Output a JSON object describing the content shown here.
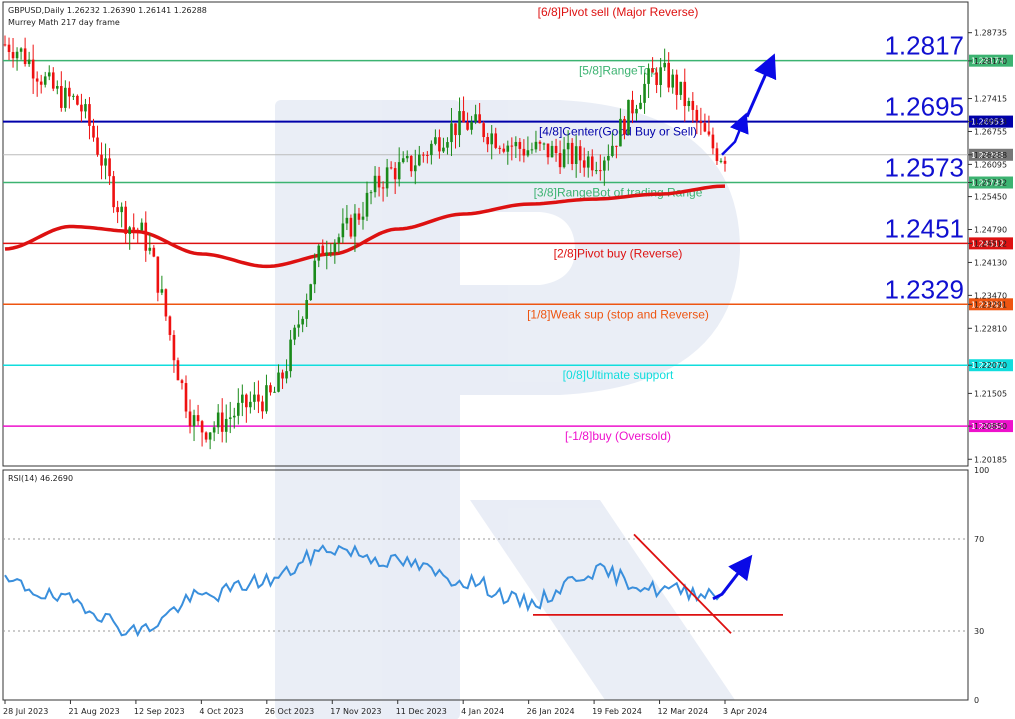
{
  "header": {
    "symbol_info": "GBPUSD,Daily  1.26232 1.26390 1.26141 1.26288",
    "indicator": "Murrey Math 217 day frame"
  },
  "rsi_header": "RSI(14) 46.2690",
  "chart_data": {
    "type": "candlestick",
    "symbol": "GBPUSD",
    "timeframe": "Daily",
    "ohlc_last": {
      "open": 1.26232,
      "high": 1.2639,
      "low": 1.26141,
      "close": 1.26288
    },
    "current_price": 1.26288,
    "price_axis": {
      "range": [
        1.2005,
        1.2935
      ],
      "ticks": [
        1.28735,
        1.2817,
        1.27415,
        1.26953,
        1.26755,
        1.26288,
        1.26095,
        1.25732,
        1.2545,
        1.2479,
        1.24512,
        1.2413,
        1.2347,
        1.23291,
        1.2281,
        1.2207,
        1.21505,
        1.2085,
        1.20185
      ]
    },
    "x_axis_labels": [
      "28 Jul 2023",
      "21 Aug 2023",
      "12 Sep 2023",
      "4 Oct 2023",
      "26 Oct 2023",
      "17 Nov 2023",
      "11 Dec 2023",
      "4 Jan 2024",
      "26 Jan 2024",
      "19 Feb 2024",
      "12 Mar 2024",
      "3 Apr 2024"
    ],
    "close_path": [
      [
        "28 Jul 2023",
        1.285
      ],
      [
        "21 Aug 2023",
        1.274
      ],
      [
        "12 Sep 2023",
        1.248
      ],
      [
        "4 Oct 2023",
        1.208
      ],
      [
        "26 Oct 2023",
        1.214
      ],
      [
        "17 Nov 2023",
        1.246
      ],
      [
        "11 Dec 2023",
        1.26
      ],
      [
        "4 Jan 2024",
        1.269
      ],
      [
        "26 Jan 2024",
        1.264
      ],
      [
        "19 Feb 2024",
        1.262
      ],
      [
        "12 Mar 2024",
        1.279
      ],
      [
        "3 Apr 2024",
        1.2629
      ]
    ],
    "moving_average": [
      [
        "28 Jul 2023",
        1.244
      ],
      [
        "21 Aug 2023",
        1.2485
      ],
      [
        "12 Sep 2023",
        1.2475
      ],
      [
        "4 Oct 2023",
        1.243
      ],
      [
        "26 Oct 2023",
        1.2405
      ],
      [
        "17 Nov 2023",
        1.243
      ],
      [
        "11 Dec 2023",
        1.248
      ],
      [
        "4 Jan 2024",
        1.251
      ],
      [
        "26 Jan 2024",
        1.253
      ],
      [
        "19 Feb 2024",
        1.254
      ],
      [
        "12 Mar 2024",
        1.255
      ],
      [
        "3 Apr 2024",
        1.2566
      ]
    ],
    "levels": [
      {
        "price": 1.2939,
        "label": "[6/8]Pivot sell (Major Reverse)",
        "color": "#dd1111",
        "big": "",
        "tag": ""
      },
      {
        "price": 1.28174,
        "label": "[5/8]RangeTop",
        "color": "#3cb371",
        "big": "1.2817",
        "tag": "1.28174"
      },
      {
        "price": 1.26953,
        "label": "[4/8]Center(Good Buy or Sell)",
        "color": "#0000aa",
        "big": "1.2695",
        "tag": "1.26953"
      },
      {
        "price": 1.25732,
        "label": "[3/8]RangeBot of trading Range",
        "color": "#3cb371",
        "big": "1.2573",
        "tag": "1.25732"
      },
      {
        "price": 1.24512,
        "label": "[2/8]Pivot buy (Reverse)",
        "color": "#dd1111",
        "big": "1.2451",
        "tag": "1.24512"
      },
      {
        "price": 1.23291,
        "label": "[1/8]Weak sup (stop and Reverse)",
        "color": "#ee5511",
        "big": "1.2329",
        "tag": "1.23291"
      },
      {
        "price": 1.2207,
        "label": "[0/8]Ultimate support",
        "color": "#11dddd",
        "big": "",
        "tag": "1.22070"
      },
      {
        "price": 1.2085,
        "label": "[-1/8]buy (Oversold)",
        "color": "#ee11cc",
        "big": "",
        "tag": "1.20850"
      }
    ],
    "rsi": {
      "period": 14,
      "value": 46.269,
      "range": [
        0,
        100
      ],
      "ticks": [
        100,
        70,
        30,
        0
      ],
      "levels": [
        70,
        30
      ],
      "path": [
        [
          "28 Jul 2023",
          51
        ],
        [
          "21 Aug 2023",
          43
        ],
        [
          "12 Sep 2023",
          30
        ],
        [
          "4 Oct 2023",
          45
        ],
        [
          "26 Oct 2023",
          52
        ],
        [
          "17 Nov 2023",
          66
        ],
        [
          "11 Dec 2023",
          60
        ],
        [
          "4 Jan 2024",
          52
        ],
        [
          "26 Jan 2024",
          42
        ],
        [
          "19 Feb 2024",
          56
        ],
        [
          "12 Mar 2024",
          48
        ],
        [
          "3 Apr 2024",
          46.269
        ]
      ]
    },
    "annotations": [
      "up-arrow-projection",
      "falling-trendline",
      "rsi-support-line",
      "rsi-up-arrow"
    ],
    "colors": {
      "bull": "#1a8a1a",
      "bear": "#ee1111",
      "ma": "#dd1111",
      "rsi": "#3a8fdc",
      "arrow": "#0a0ae6",
      "price_tag_bg": "#777777"
    }
  }
}
